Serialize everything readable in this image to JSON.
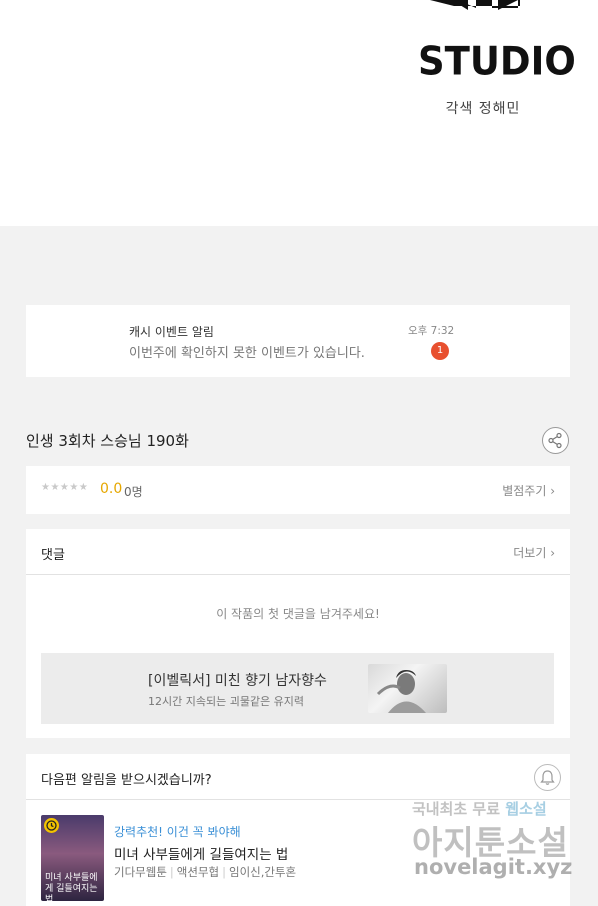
{
  "studio": {
    "logo_text": "STUDIO",
    "credit": "각색 정해민"
  },
  "notice": {
    "title": "캐시 이벤트 알림",
    "body": "이번주에 확인하지 못한 이벤트가 있습니다.",
    "time": "오후 7:32",
    "badge_count": "1"
  },
  "episode": {
    "title": "인생 3회차 스승님 190화"
  },
  "rating": {
    "stars": "★★★★★",
    "score": "0.0",
    "count": "0명",
    "rate_link": "별점주기 ›"
  },
  "comments": {
    "title": "댓글",
    "more": "더보기 ›",
    "empty_message": "이 작품의 첫 댓글을 남겨주세요!"
  },
  "ad": {
    "title": "[이벨릭서] 미친 향기 남자향수",
    "subtitle": "12시간 지속되는 괴물같은 유지력"
  },
  "alarm": {
    "question": "다음편 알림을 받으시겠습니까?"
  },
  "recommendation": {
    "label": "강력추천! 이건 꼭 봐야해",
    "title": "미녀 사부들에게 길들여지는 법",
    "thumb_text": "미녀 사부들에게 길들여지는 법",
    "tags": [
      "기다무웹툰",
      "액션무협",
      "임이신,간투혼"
    ]
  },
  "watermark": {
    "line1_a": "국내최초 무료",
    "line1_b": "웹소설",
    "line2": "아지툰소설",
    "line3": "novelagit.xyz"
  },
  "colors": {
    "badge": "#e8502f",
    "score": "#e6a700",
    "rec_label": "#3a8fd6"
  }
}
